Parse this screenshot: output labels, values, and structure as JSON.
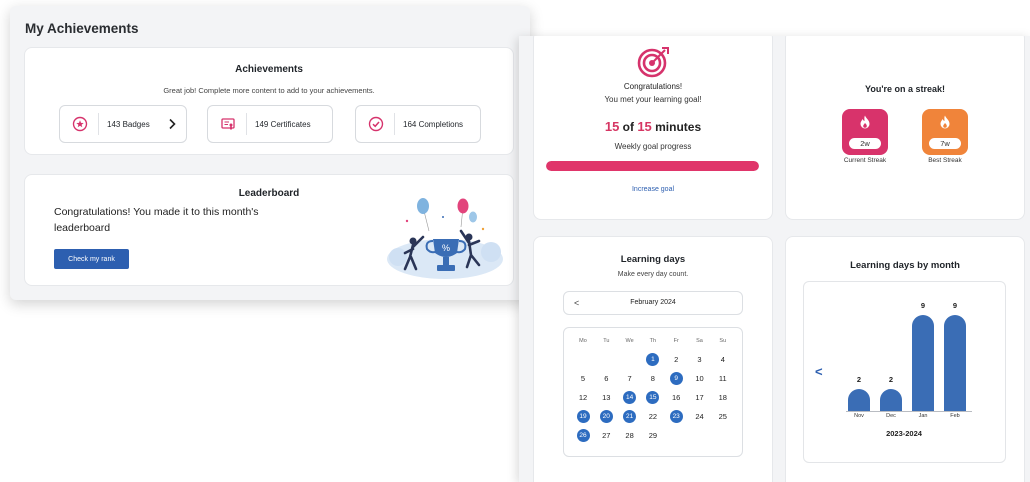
{
  "left_window": {
    "title": "My Achievements",
    "achievements": {
      "title": "Achievements",
      "subtitle": "Great job! Complete more content to add to your achievements.",
      "badges": "143 Badges",
      "certificates": "149 Certificates",
      "completions": "164 Completions"
    },
    "leaderboard": {
      "title": "Leaderboard",
      "message": "Congratulations! You made it to this month's leaderboard",
      "button": "Check my rank"
    }
  },
  "goal": {
    "congrats": "Congratulations!",
    "met": "You met your learning goal!",
    "done": "15",
    "of": "of",
    "total": "15",
    "unit": "minutes",
    "label": "Weekly goal progress",
    "progress": 1.0,
    "link": "Increase goal"
  },
  "streak": {
    "title": "You're on a streak!",
    "current_value": "2w",
    "current_label": "Current Streak",
    "best_value": "7w",
    "best_label": "Best Streak",
    "current_color": "#d8336b",
    "best_color": "#f0843a"
  },
  "learning_days": {
    "title": "Learning days",
    "subtitle": "Make every day count.",
    "prev": "<",
    "month": "February 2024",
    "weekdays": [
      "Mo",
      "Tu",
      "We",
      "Th",
      "Fr",
      "Sa",
      "Su"
    ],
    "days": [
      [
        "",
        "",
        "",
        "1",
        "2",
        "3",
        "4"
      ],
      [
        "5",
        "6",
        "7",
        "8",
        "9",
        "10",
        "11"
      ],
      [
        "12",
        "13",
        "14",
        "15",
        "16",
        "17",
        "18"
      ],
      [
        "19",
        "20",
        "21",
        "22",
        "23",
        "24",
        "25"
      ],
      [
        "26",
        "27",
        "28",
        "29",
        "",
        "",
        ""
      ]
    ],
    "highlighted": [
      "1",
      "9",
      "14",
      "15",
      "19",
      "20",
      "21",
      "23",
      "26"
    ]
  },
  "by_month": {
    "title": "Learning days by month",
    "back": "<",
    "period": "2023-2024"
  },
  "chart_data": {
    "type": "bar",
    "categories": [
      "Nov",
      "Dec",
      "Jan",
      "Feb"
    ],
    "values": [
      2,
      2,
      9,
      9
    ],
    "title": "Learning days by month",
    "xlabel": "2023-2024",
    "ylabel": "",
    "ylim": [
      0,
      9
    ],
    "color": "#3a6db5"
  }
}
